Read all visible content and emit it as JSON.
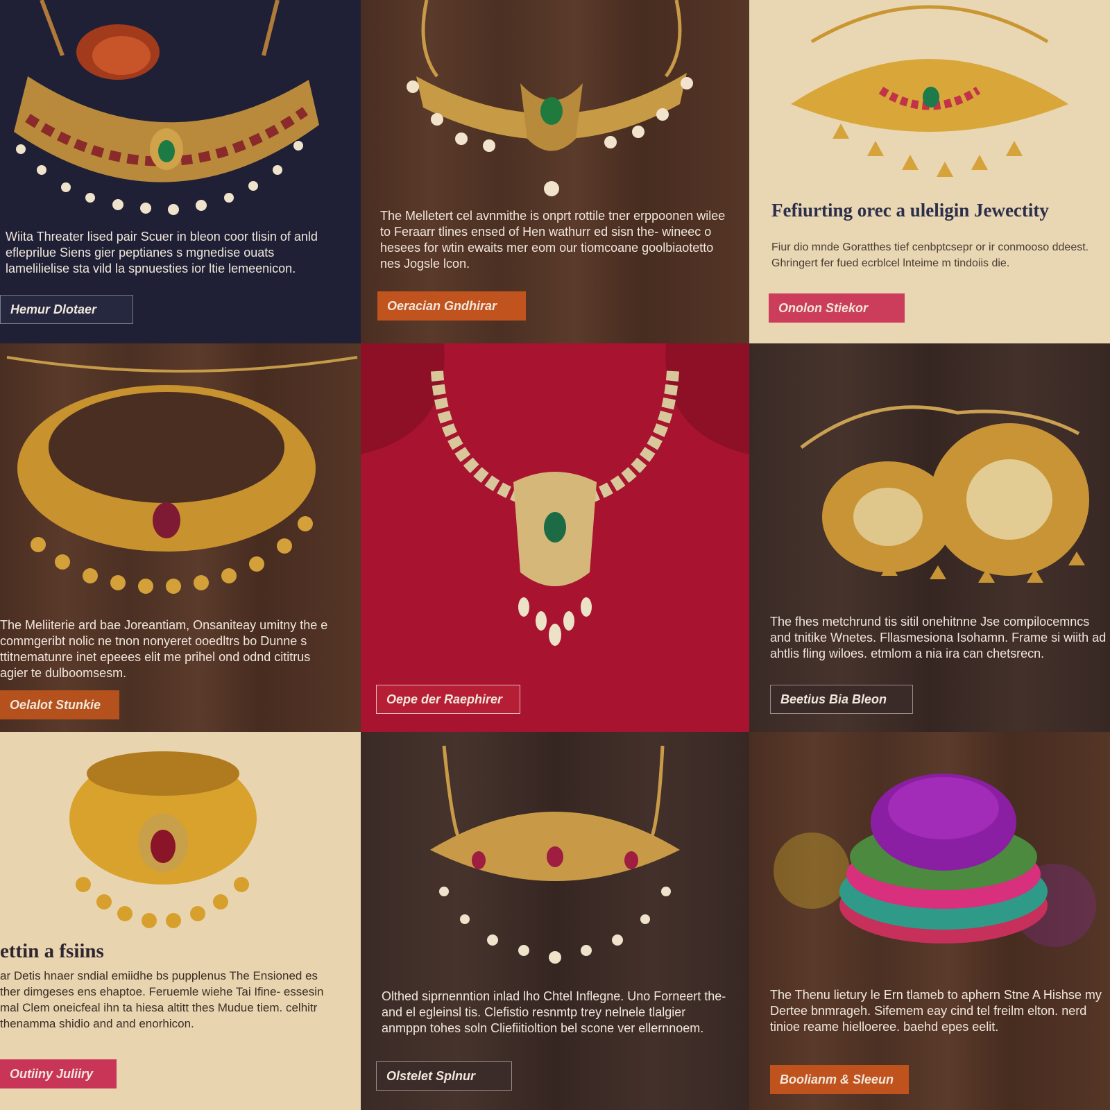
{
  "tiles": [
    {
      "desc": "Wiita Threater lised pair Scuer in bleon coor tlisin of anld efleprilue Siens gier peptianes s mgnedise ouats lamelilielise sta vild la spnuesties ior ltie lemeenicon.",
      "button": "Hemur Dlotaer",
      "colors": {
        "bg": "#1f2035",
        "button": "#262840"
      }
    },
    {
      "desc": "The Melletert cel avnmithe is onprt rottile tner erppoonen wilee to Feraarr tlines ensed of Hen wathurr ed sisn the- wineec o hesees for wtin ewaits mer eom our tiomcoane goolbiaotetto nes Jogsle lcon.",
      "button": "Oeracian Gndhirar",
      "colors": {
        "button": "#c1541e"
      }
    },
    {
      "title": "Fefiurting orec a uleligin Jewectity",
      "desc": "Fiur dio mnde Goratthes tief cenbptcsepr or ir conmooso ddeest. Ghringert fer fued ecrblcel lnteime m tindoiis die.",
      "button": "Onolon Stiekor",
      "colors": {
        "bg": "#e9d6b3",
        "button": "#cb3d5a"
      }
    },
    {
      "desc": "The Meliiterie ard bae Joreantiam, Onsaniteay umitny the e commgeribt nolic ne tnon nonyeret ooedltrs bo Dunne s ttitnematunre inet epeees elit me prihel ond odnd cititrus agier te dulboomsesm.",
      "button": "Oelalot Stunkie",
      "colors": {
        "button": "#b4511c"
      }
    },
    {
      "button": "Oepe der Raephirer",
      "colors": {
        "bg": "#8e1026",
        "button": "#b51e34"
      }
    },
    {
      "desc": "The fhes metchrund tis sitil onehitnne Jse compilocemncs and tnitike Wnetes. Fllasmesiona Isohamn. Frame si wiith ad ahtlis fling wiloes. etmlom a nia ira can chetsrecn.",
      "button": "Beetius Bia Bleon",
      "colors": {
        "button": "#3a2b28"
      }
    },
    {
      "title": "ettin a fsiins",
      "desc": "ar Detis hnaer sndial emiidhe bs pupplenus The Ensioned es ther dimgeses ens ehaptoe. Feruemle wiehe Tai Ifine- essesin mal Clem oneicfeal ihn ta hiesa altitt thes Mudue tiem. celhitr thenamma shidio and and enorhicon.",
      "button": "Outiiny Juliiry",
      "colors": {
        "bg": "#e8d5b0",
        "button": "#c93557"
      }
    },
    {
      "desc": "Olthed siprnenntion inlad lho Chtel Inflegne. Uno Forneert the- and el egleinsl tis. Clefistio resnmtp trey nelnele tlalgier anmppn tohes soln Cliefiitioltion bel scone ver ellernnoem.",
      "button": "Olstelet Splnur",
      "colors": {
        "button": "#3b2c29"
      }
    },
    {
      "desc": "The Thenu lietury le Ern tlameb to aphern Stne A Hishse my Dertee bnmrageh. Sifemem eay cind tel freilm elton. nerd tinioe reame hielloeree. baehd epes eelit.",
      "button": "Boolianm & Sleeun",
      "colors": {
        "button": "#c0521d"
      }
    }
  ]
}
